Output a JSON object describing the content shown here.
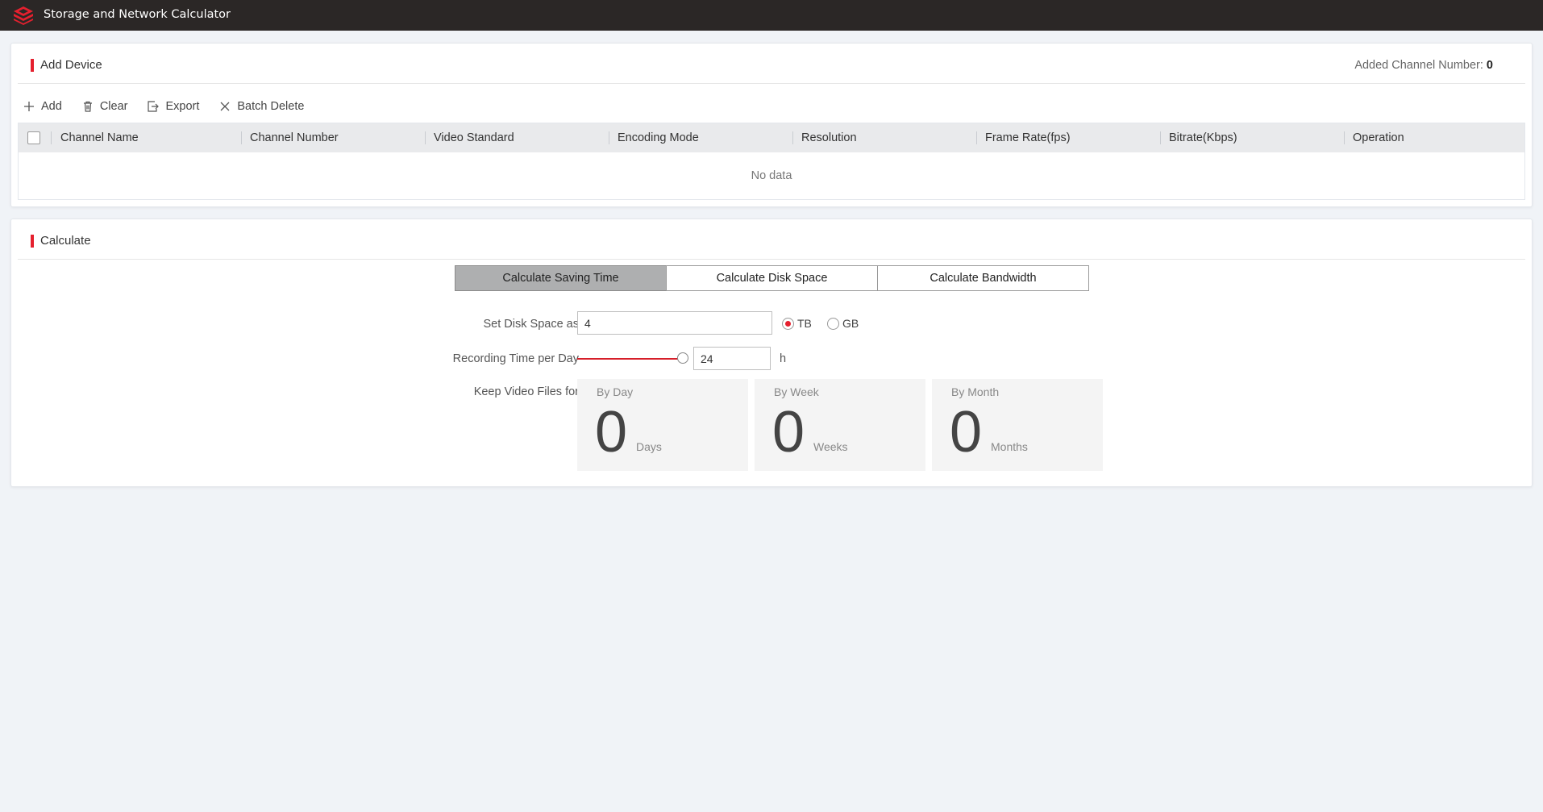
{
  "app": {
    "title": "Storage and Network Calculator",
    "logo_icon": "hik-logo-icon",
    "brand_color": "#e5202e"
  },
  "add_device": {
    "title": "Add Device",
    "added_label": "Added Channel Number:",
    "added_value": "0",
    "toolbar": [
      {
        "label": "Add",
        "icon": "plus-icon"
      },
      {
        "label": "Clear",
        "icon": "trash-icon"
      },
      {
        "label": "Export",
        "icon": "export-icon"
      },
      {
        "label": "Batch Delete",
        "icon": "close-icon"
      }
    ],
    "columns": [
      "Channel Name",
      "Channel Number",
      "Video Standard",
      "Encoding Mode",
      "Resolution",
      "Frame Rate(fps)",
      "Bitrate(Kbps)",
      "Operation"
    ],
    "empty_text": "No data"
  },
  "calculate": {
    "title": "Calculate",
    "tabs": [
      "Calculate Saving Time",
      "Calculate Disk Space",
      "Calculate Bandwidth"
    ],
    "active_tab": 0,
    "disk_label": "Set Disk Space as",
    "disk_value": "4",
    "units": [
      "TB",
      "GB"
    ],
    "selected_unit": "TB",
    "recording_label": "Recording Time per Day",
    "recording_value": "24",
    "recording_max": 24,
    "recording_unit": "h",
    "keep_label": "Keep Video Files for",
    "results": [
      {
        "label": "By Day",
        "value": "0",
        "unit": "Days"
      },
      {
        "label": "By Week",
        "value": "0",
        "unit": "Weeks"
      },
      {
        "label": "By Month",
        "value": "0",
        "unit": "Months"
      }
    ]
  }
}
